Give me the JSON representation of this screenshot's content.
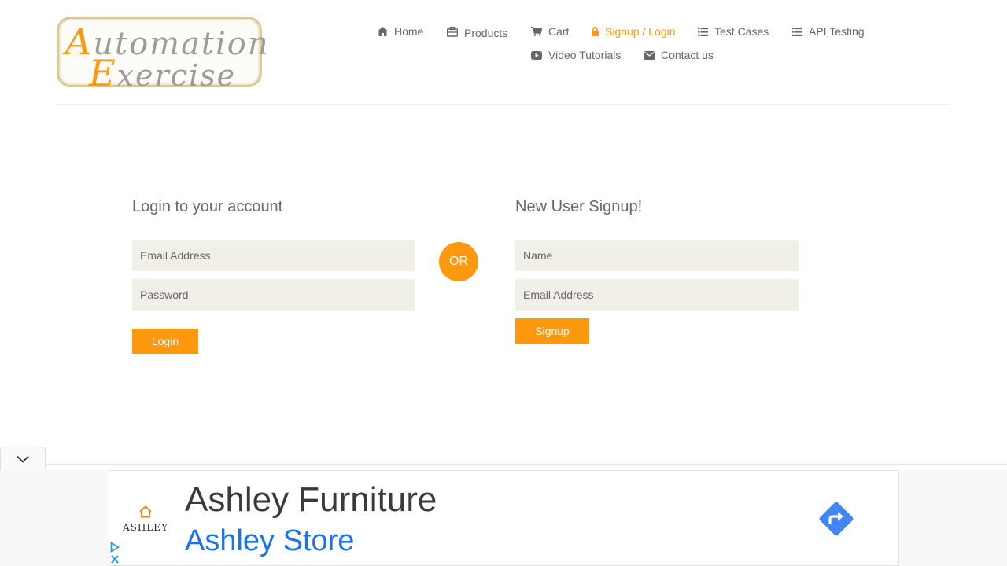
{
  "logo": {
    "line1_cap": "A",
    "line1_rest": "utomation",
    "line2_cap": "E",
    "line2_rest": "xercise"
  },
  "nav": {
    "home": "Home",
    "products": "Products",
    "cart": "Cart",
    "signup_login": "Signup / Login",
    "test_cases": "Test Cases",
    "api_testing": "API Testing",
    "video_tutorials": "Video Tutorials",
    "contact_us": "Contact us"
  },
  "login": {
    "title": "Login to your account",
    "email_placeholder": "Email Address",
    "password_placeholder": "Password",
    "button": "Login"
  },
  "or_label": "OR",
  "signup": {
    "title": "New User Signup!",
    "name_placeholder": "Name",
    "email_placeholder": "Email Address",
    "button": "Signup"
  },
  "ad": {
    "brand_logo_text": "ASHLEY",
    "headline": "Ashley Furniture",
    "subline": "Ashley Store"
  },
  "colors": {
    "accent": "#fe980f",
    "field_bg": "#f0f0e9",
    "text": "#696763",
    "ad_link": "#1a73e8"
  },
  "icons": [
    "home-icon",
    "briefcase-icon",
    "cart-icon",
    "lock-icon",
    "list-icon",
    "youtube-play-icon",
    "envelope-icon",
    "chevron-down-icon",
    "directions-arrow-icon",
    "adchoices-icon",
    "close-icon"
  ]
}
